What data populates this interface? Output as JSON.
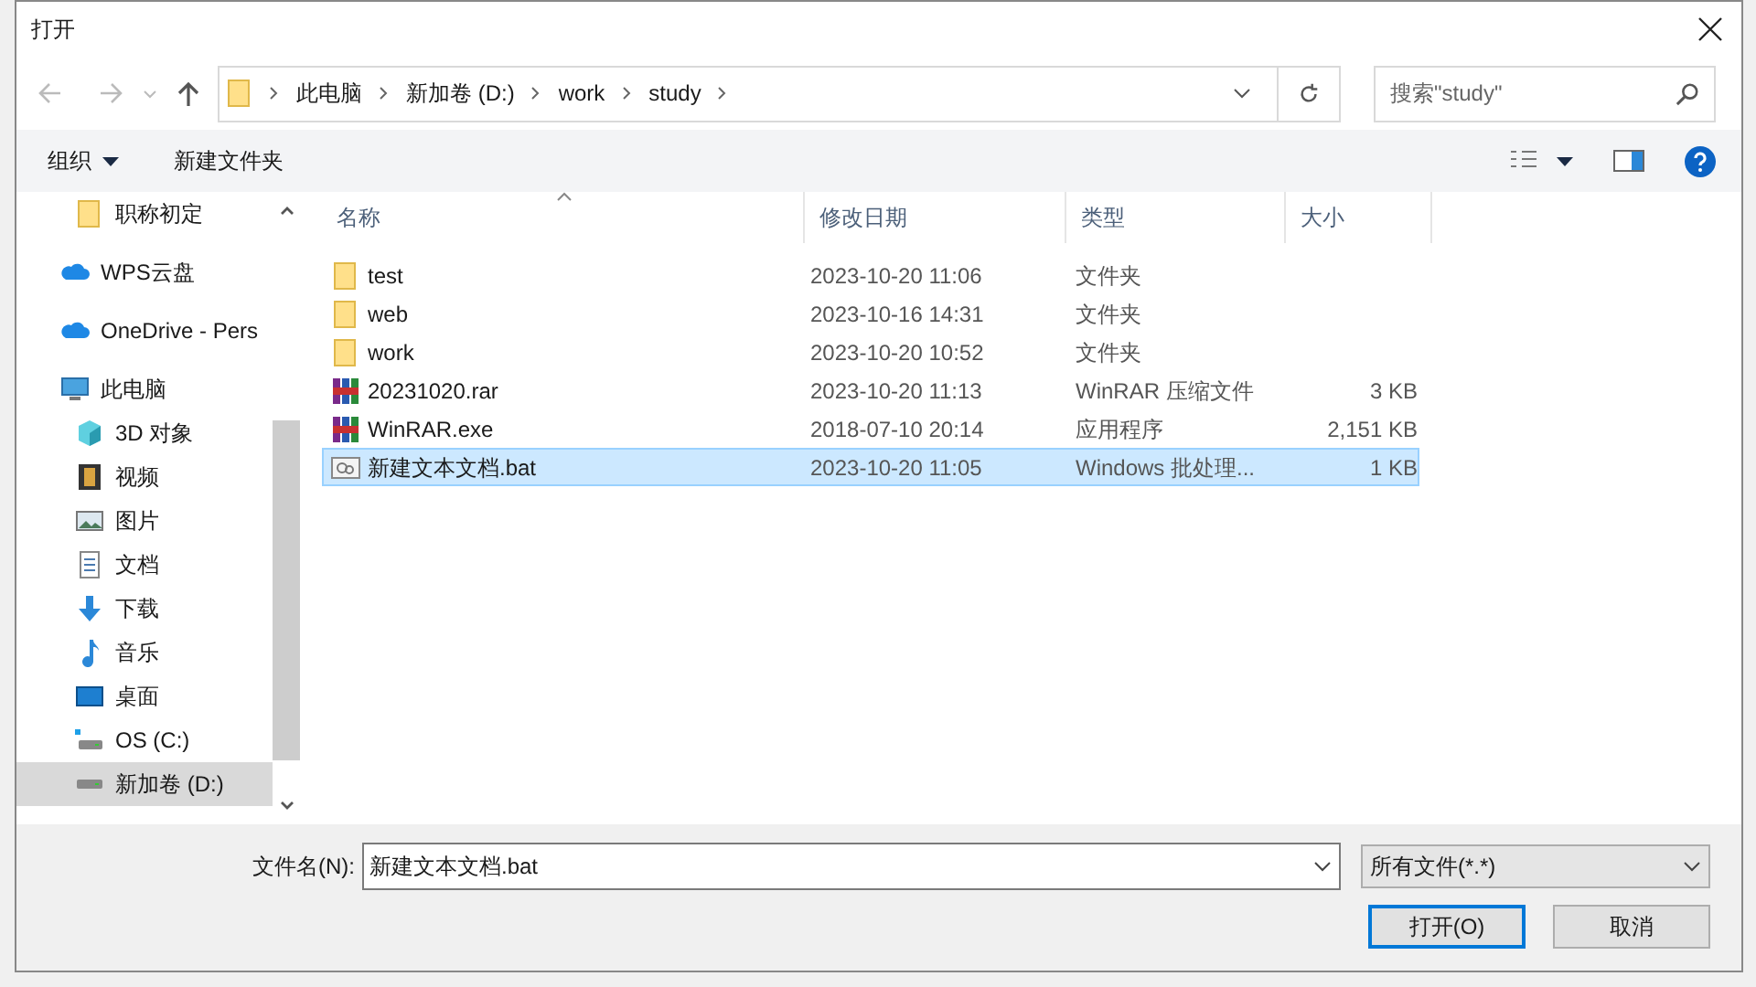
{
  "window": {
    "title": "打开"
  },
  "address": {
    "crumbs": [
      "此电脑",
      "新加卷 (D:)",
      "work",
      "study"
    ]
  },
  "search": {
    "placeholder": "搜索\"study\""
  },
  "toolbar": {
    "organize": "组织",
    "new_folder": "新建文件夹"
  },
  "nav": {
    "items": [
      {
        "children": [
          {
            "label": "职称初定",
            "kind": "folder",
            "selected": false
          }
        ]
      },
      {
        "label": "WPS云盘",
        "kind": "cloud",
        "selected": false
      },
      {
        "label": "OneDrive - Pers",
        "kind": "cloud",
        "selected": false
      },
      {
        "label": "此电脑",
        "kind": "pc",
        "selected": false,
        "children": [
          {
            "label": "3D 对象",
            "kind": "cube",
            "selected": false
          },
          {
            "label": "视频",
            "kind": "film",
            "selected": false
          },
          {
            "label": "图片",
            "kind": "image",
            "selected": false
          },
          {
            "label": "文档",
            "kind": "doc",
            "selected": false
          },
          {
            "label": "下载",
            "kind": "download",
            "selected": false
          },
          {
            "label": "音乐",
            "kind": "music",
            "selected": false
          },
          {
            "label": "桌面",
            "kind": "desktop",
            "selected": false
          },
          {
            "label": "OS (C:)",
            "kind": "osdrive",
            "selected": false
          },
          {
            "label": "新加卷 (D:)",
            "kind": "drive",
            "selected": true
          }
        ]
      }
    ]
  },
  "table": {
    "columns": [
      "名称",
      "修改日期",
      "类型",
      "大小"
    ],
    "rows": [
      {
        "kind": "folder",
        "name": "test",
        "date": "2023-10-20 11:06",
        "type": "文件夹",
        "selected": false
      },
      {
        "kind": "folder",
        "name": "web",
        "date": "2023-10-16 14:31",
        "type": "文件夹",
        "selected": false
      },
      {
        "kind": "folder",
        "name": "work",
        "date": "2023-10-20 10:52",
        "type": "文件夹",
        "selected": false
      },
      {
        "kind": "archive",
        "name": "20231020.rar",
        "date": "2023-10-20 11:13",
        "type": "WinRAR 压缩文件",
        "size": "3 KB",
        "selected": false
      },
      {
        "kind": "archive",
        "name": "WinRAR.exe",
        "date": "2018-07-10 20:14",
        "type": "应用程序",
        "size": "2,151 KB",
        "selected": false
      },
      {
        "kind": "batch",
        "name": "新建文本文档.bat",
        "date": "2023-10-20 11:05",
        "type": "Windows 批处理...",
        "size": "1 KB",
        "selected": true
      }
    ]
  },
  "footer": {
    "filename_label": "文件名(N):",
    "filename": "新建文本文档.bat",
    "filter": "所有文件(*.*)",
    "open": "打开(O)",
    "cancel": "取消"
  }
}
